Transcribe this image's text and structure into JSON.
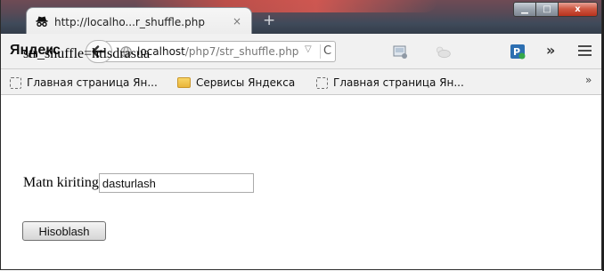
{
  "tab": {
    "title": "http://localho...r_shuffle.php",
    "close_symbol": "×",
    "new_tab_symbol": "+"
  },
  "window_controls": {
    "minimize_symbol": "▁",
    "maximize_symbol": "□",
    "close_symbol": "x"
  },
  "navbar": {
    "logo": "Яндекс",
    "url_host": "localhost",
    "url_path": "/php7/str_shuffle.php",
    "dropdown_symbol": "▽",
    "reload_symbol": "C",
    "overflow_symbol": "»"
  },
  "bookmarks": {
    "items": [
      {
        "label": "Главная страница Ян...",
        "icon": "page-icon"
      },
      {
        "label": "Сервисы Яндекса",
        "icon": "folder-icon"
      },
      {
        "label": "Главная страница Ян...",
        "icon": "page-icon"
      }
    ],
    "overflow_symbol": "»"
  },
  "page": {
    "result_text": "str_shuffle=htlsdrasua",
    "input_label": "Matn kiriting",
    "input_value": "dasturlash",
    "submit_label": "Hisoblash"
  },
  "colors": {
    "yandex_red": "#e61400",
    "titlebar": "#3f4a5a",
    "toolbar": "#f1f1f1"
  }
}
